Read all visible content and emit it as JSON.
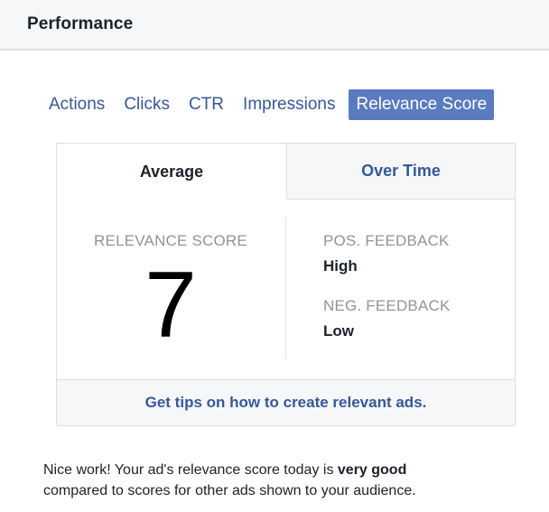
{
  "header": {
    "title": "Performance"
  },
  "metric_tabs": [
    {
      "label": "Actions",
      "active": false
    },
    {
      "label": "Clicks",
      "active": false
    },
    {
      "label": "CTR",
      "active": false
    },
    {
      "label": "Impressions",
      "active": false
    },
    {
      "label": "Relevance Score",
      "active": true
    }
  ],
  "card": {
    "subtabs": {
      "average": "Average",
      "over_time": "Over Time",
      "selected": "Average"
    },
    "score_label": "RELEVANCE SCORE",
    "score_value": "7",
    "positive_feedback": {
      "label": "POS. FEEDBACK",
      "value": "High"
    },
    "negative_feedback": {
      "label": "NEG. FEEDBACK",
      "value": "Low"
    },
    "tips_link": "Get tips on how to create relevant ads."
  },
  "message": {
    "prefix": "Nice work! Your ad's relevance score today is ",
    "emphasis": "very good",
    "suffix": "compared to scores for other ads shown to your audience."
  },
  "colors": {
    "link": "#365899",
    "active_tab_bg": "#5b7bc0",
    "muted_text": "#90949c",
    "panel_bg": "#f6f7f9",
    "border": "#dddfe2"
  }
}
